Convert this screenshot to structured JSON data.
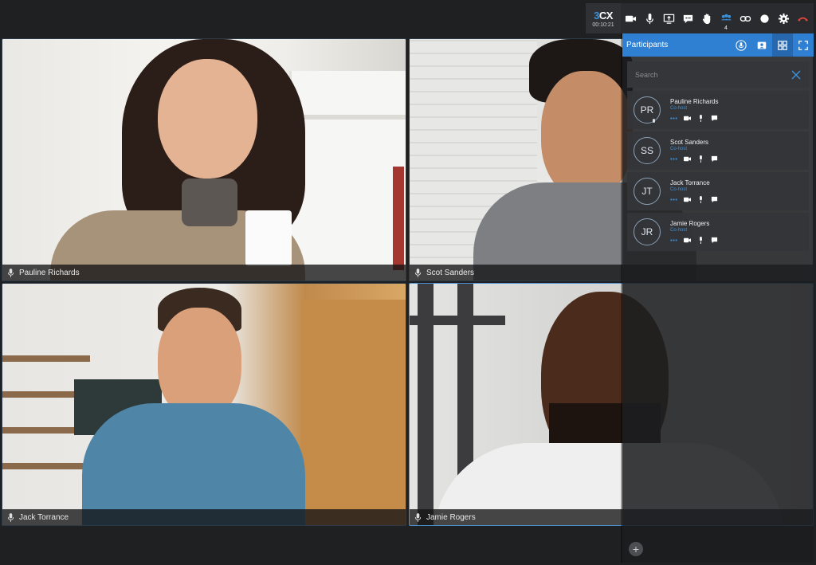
{
  "brand": {
    "logo_prefix": "3",
    "logo_suffix": "CX",
    "timer": "00:10:21"
  },
  "toolbar": {
    "buttons": [
      "camera-icon",
      "microphone-icon",
      "share-screen-icon",
      "chat-icon",
      "raise-hand-icon",
      "participants-icon",
      "link-icon",
      "record-icon",
      "gear-icon",
      "hangup-icon"
    ],
    "participants_count": "4",
    "accent": "#3d8fd6",
    "hangup_color": "#e0463b"
  },
  "tiles": [
    {
      "name": "Pauline Richards"
    },
    {
      "name": "Scot Sanders"
    },
    {
      "name": "Jack Torrance"
    },
    {
      "name": "Jamie Rogers"
    }
  ],
  "panel": {
    "title": "Participants",
    "search_placeholder": "Search",
    "header_color": "#2f7fd2",
    "participants": [
      {
        "initials": "PR",
        "name": "Pauline Richards",
        "role": "Co-host"
      },
      {
        "initials": "SS",
        "name": "Scot Sanders",
        "role": "Co-host"
      },
      {
        "initials": "JT",
        "name": "Jack Torrance",
        "role": "Co-host"
      },
      {
        "initials": "JR",
        "name": "Jamie Rogers",
        "role": "Co-host"
      }
    ],
    "add_label": "+"
  }
}
